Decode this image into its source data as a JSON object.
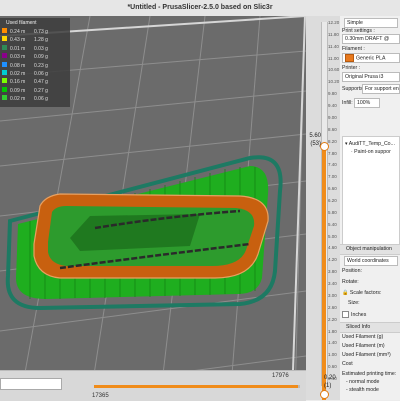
{
  "window": {
    "title": "*Untitled - PrusaSlicer-2.5.0 based on Slic3r"
  },
  "legend": {
    "header": "Used filament",
    "rows": [
      {
        "color": "#ff8c00",
        "length": "0.24 m",
        "weight": "0.73 g"
      },
      {
        "color": "#ffd700",
        "length": "0.43 m",
        "weight": "1.28 g"
      },
      {
        "color": "#2e8b57",
        "length": "0.01 m",
        "weight": "0.03 g"
      },
      {
        "color": "#8b008b",
        "length": "0.03 m",
        "weight": "0.09 g"
      },
      {
        "color": "#1e90ff",
        "length": "0.08 m",
        "weight": "0.23 g"
      },
      {
        "color": "#00ced1",
        "length": "0.02 m",
        "weight": "0.06 g"
      },
      {
        "color": "#7cfc00",
        "length": "0.16 m",
        "weight": "0.47 g"
      },
      {
        "color": "#00c800",
        "length": "0.09 m",
        "weight": "0.27 g"
      },
      {
        "color": "#32cd32",
        "length": "0.02 m",
        "weight": "0.06 g"
      }
    ]
  },
  "vertical_slider": {
    "ticks": [
      "12.20",
      "11.80",
      "11.40",
      "11.00",
      "10.60",
      "10.20",
      "9.80",
      "9.40",
      "9.00",
      "8.60",
      "8.20",
      "7.80",
      "7.40",
      "7.00",
      "6.60",
      "6.20",
      "5.80",
      "5.40",
      "5.00",
      "4.60",
      "4.20",
      "3.80",
      "3.40",
      "3.00",
      "2.60",
      "2.20",
      "1.80",
      "1.40",
      "1.00",
      "0.60",
      "0.40"
    ],
    "current_height": "5.60",
    "current_layer": "(53)",
    "bottom_height": "0.20",
    "bottom_layer": "(1)"
  },
  "horizontal_slider": {
    "left_value": "17365",
    "right_value": "17976"
  },
  "sidebar": {
    "mode_label": "Simple",
    "print_settings_label": "Print settings :",
    "print_settings_value": "0.30mm DRAFT @",
    "filament_label": "Filament :",
    "filament_value": "Generic PLA",
    "filament_color": "#e8791d",
    "printer_label": "Printer :",
    "printer_value": "Original Prusa i3",
    "supports_label": "Supports:",
    "supports_value": "For support en",
    "infill_label": "Infill:",
    "infill_value": "100%",
    "object_name": "AudiTT_Temp_Co...",
    "object_sub": "Paint-on suppor",
    "object_manipulation_header": "Object manipulation",
    "coordinates_value": "World coordinates",
    "position_label": "Position:",
    "rotate_label": "Rotate:",
    "scale_label": "Scale factors:",
    "size_label": "Size:",
    "inches_label": "Inches",
    "sliced_info_header": "Sliced Info",
    "used_filament_g": "Used Filament (g)",
    "used_filament_m": "Used Filament (m)",
    "used_filament_mm3": "Used Filament (mm³)",
    "cost_label": "Cost",
    "est_time_label": "Estimated printing time:",
    "normal_mode": "- normal mode",
    "stealth_mode": "- stealth mode"
  }
}
